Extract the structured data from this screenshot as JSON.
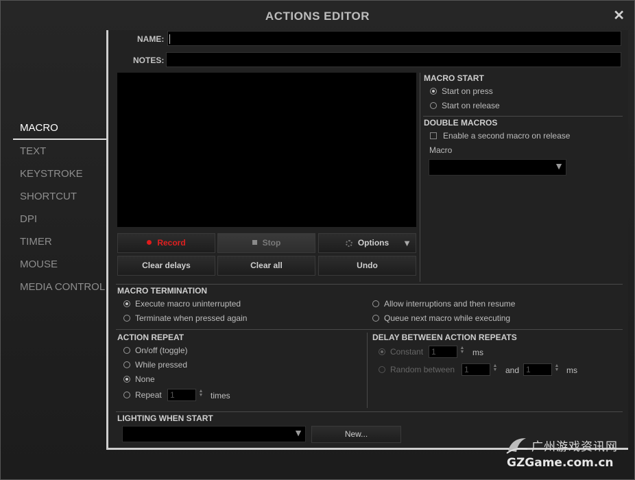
{
  "window": {
    "title": "ACTIONS EDITOR",
    "close_glyph": "✕"
  },
  "sidebar": {
    "items": [
      {
        "label": "MACRO",
        "active": true
      },
      {
        "label": "TEXT"
      },
      {
        "label": "KEYSTROKE"
      },
      {
        "label": "SHORTCUT"
      },
      {
        "label": "DPI"
      },
      {
        "label": "TIMER"
      },
      {
        "label": "MOUSE"
      },
      {
        "label": "MEDIA CONTROL"
      }
    ]
  },
  "form": {
    "name_label": "NAME:",
    "name_value": "",
    "notes_label": "NOTES:",
    "notes_value": ""
  },
  "recorder": {
    "record_label": "Record",
    "stop_label": "Stop",
    "options_label": "Options",
    "clear_delays_label": "Clear delays",
    "clear_all_label": "Clear all",
    "undo_label": "Undo"
  },
  "macro_start": {
    "title": "MACRO START",
    "options": [
      "Start on press",
      "Start on release"
    ],
    "selected": 0
  },
  "double_macros": {
    "title": "DOUBLE MACROS",
    "checkbox_label": "Enable a second macro on release",
    "macro_label": "Macro",
    "macro_value": ""
  },
  "termination": {
    "title": "MACRO TERMINATION",
    "options": [
      "Execute macro uninterrupted",
      "Terminate when pressed again",
      "Allow interruptions and then resume",
      "Queue next macro while executing"
    ],
    "selected": 0
  },
  "action_repeat": {
    "title": "ACTION REPEAT",
    "options": [
      "On/off (toggle)",
      "While pressed",
      "None",
      "Repeat"
    ],
    "selected": 2,
    "repeat_value": "1",
    "repeat_unit": "times"
  },
  "delay_repeats": {
    "title": "DELAY BETWEEN ACTION REPEATS",
    "constant_label": "Constant",
    "constant_value": "1",
    "constant_unit": "ms",
    "random_label": "Random between",
    "random_min": "1",
    "and_label": "and",
    "random_max": "1",
    "random_unit": "ms"
  },
  "lighting": {
    "title": "LIGHTING WHEN START",
    "value": "",
    "new_label": "New..."
  },
  "watermark": {
    "cn": "广州游戏资讯网",
    "en": "GZGame.com.cn"
  },
  "colors": {
    "accent_record": "#e01b1b",
    "background": "#1e1e1e",
    "field": "#000000"
  }
}
